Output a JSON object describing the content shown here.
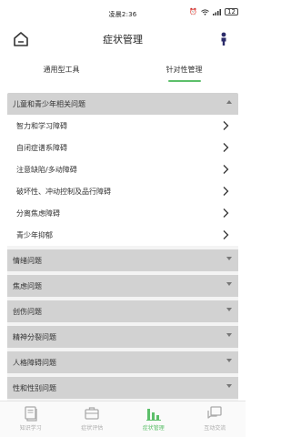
{
  "status": {
    "time": "凌晨2:36",
    "battery": "12"
  },
  "header": {
    "title": "症状管理"
  },
  "tabs": [
    {
      "label": "通用型工具",
      "active": false
    },
    {
      "label": "针对性管理",
      "active": true
    }
  ],
  "groups": [
    {
      "title": "儿童和青少年相关问题",
      "expanded": true,
      "items": [
        "智力和学习障碍",
        "自闭症谱系障碍",
        "注意缺陷/多动障碍",
        "破坏性、冲动控制及品行障碍",
        "分离焦虑障碍",
        "青少年抑郁"
      ]
    },
    {
      "title": "情绪问题",
      "expanded": false
    },
    {
      "title": "焦虑问题",
      "expanded": false
    },
    {
      "title": "创伤问题",
      "expanded": false
    },
    {
      "title": "精神分裂问题",
      "expanded": false
    },
    {
      "title": "人格障碍问题",
      "expanded": false
    },
    {
      "title": "性和性别问题",
      "expanded": false
    }
  ],
  "bottom_nav": [
    {
      "label": "知识学习",
      "icon": "book-icon",
      "active": false
    },
    {
      "label": "症状评估",
      "icon": "briefcase-icon",
      "active": false
    },
    {
      "label": "症状管理",
      "icon": "chart-icon",
      "active": true
    },
    {
      "label": "互动交流",
      "icon": "chat-icon",
      "active": false
    }
  ],
  "colors": {
    "accent": "#5cbf6a",
    "group_bg": "#d2d2d2",
    "panel_bg": "#f4f4f4"
  }
}
